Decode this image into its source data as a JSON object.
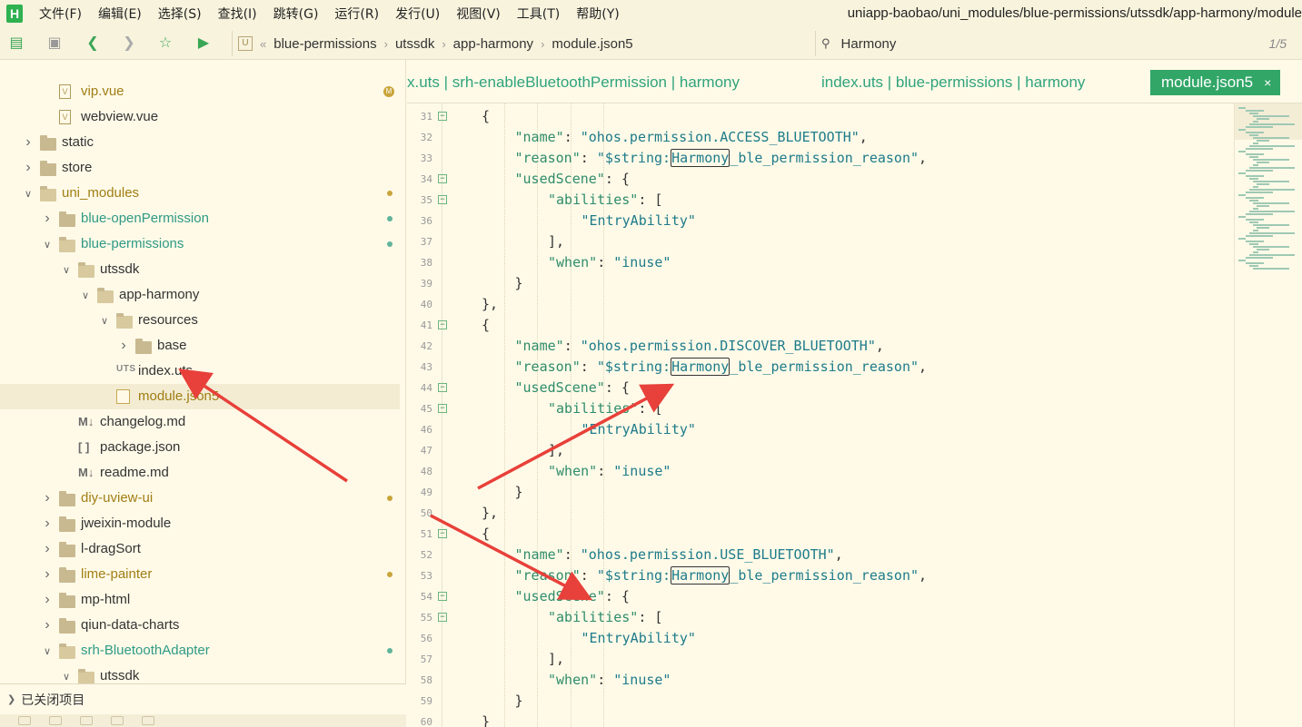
{
  "menu": {
    "items": [
      "文件(F)",
      "编辑(E)",
      "选择(S)",
      "查找(I)",
      "跳转(G)",
      "运行(R)",
      "发行(U)",
      "视图(V)",
      "工具(T)",
      "帮助(Y)"
    ],
    "title_path": "uniapp-baobao/uni_modules/blue-permissions/utssdk/app-harmony/module"
  },
  "toolbar": {
    "breadcrumbs": [
      "blue-permissions",
      "utssdk",
      "app-harmony",
      "module.json5"
    ],
    "search_label": "Harmony",
    "search_count": "1/5"
  },
  "sidebar": {
    "rows": [
      {
        "label": "vip.vue",
        "type": "file-v",
        "depth": 2,
        "chev": "",
        "status": "modified",
        "marker": "M"
      },
      {
        "label": "webview.vue",
        "type": "file-v",
        "depth": 2,
        "chev": "",
        "status": "normal",
        "marker": ""
      },
      {
        "label": "static",
        "type": "folder",
        "depth": 1,
        "chev": "right",
        "status": "normal",
        "marker": ""
      },
      {
        "label": "store",
        "type": "folder",
        "depth": 1,
        "chev": "right",
        "status": "normal",
        "marker": ""
      },
      {
        "label": "uni_modules",
        "type": "folder-open",
        "depth": 1,
        "chev": "down",
        "status": "modified",
        "marker": "yellow"
      },
      {
        "label": "blue-openPermission",
        "type": "folder",
        "depth": 2,
        "chev": "right",
        "status": "added",
        "marker": "green"
      },
      {
        "label": "blue-permissions",
        "type": "folder-open",
        "depth": 2,
        "chev": "down",
        "status": "added",
        "marker": "green"
      },
      {
        "label": "utssdk",
        "type": "folder-open",
        "depth": 3,
        "chev": "down",
        "status": "normal",
        "marker": ""
      },
      {
        "label": "app-harmony",
        "type": "folder-open",
        "depth": 4,
        "chev": "down",
        "status": "normal",
        "marker": ""
      },
      {
        "label": "resources",
        "type": "folder-open",
        "depth": 5,
        "chev": "down",
        "status": "normal",
        "marker": ""
      },
      {
        "label": "base",
        "type": "folder",
        "depth": 6,
        "chev": "right",
        "status": "normal",
        "marker": ""
      },
      {
        "label": "index.uts",
        "type": "uts",
        "depth": 5,
        "chev": "",
        "status": "normal",
        "marker": ""
      },
      {
        "label": "module.json5",
        "type": "file-g",
        "depth": 5,
        "chev": "",
        "status": "modified",
        "marker": "",
        "selected": true
      },
      {
        "label": "changelog.md",
        "type": "md",
        "depth": 3,
        "chev": "",
        "status": "normal",
        "marker": ""
      },
      {
        "label": "package.json",
        "type": "json",
        "depth": 3,
        "chev": "",
        "status": "normal",
        "marker": ""
      },
      {
        "label": "readme.md",
        "type": "md",
        "depth": 3,
        "chev": "",
        "status": "normal",
        "marker": ""
      },
      {
        "label": "diy-uview-ui",
        "type": "folder",
        "depth": 2,
        "chev": "right",
        "status": "modified",
        "marker": "yellow"
      },
      {
        "label": "jweixin-module",
        "type": "folder",
        "depth": 2,
        "chev": "right",
        "status": "normal",
        "marker": ""
      },
      {
        "label": "l-dragSort",
        "type": "folder",
        "depth": 2,
        "chev": "right",
        "status": "normal",
        "marker": ""
      },
      {
        "label": "lime-painter",
        "type": "folder",
        "depth": 2,
        "chev": "right",
        "status": "modified",
        "marker": "yellow"
      },
      {
        "label": "mp-html",
        "type": "folder",
        "depth": 2,
        "chev": "right",
        "status": "normal",
        "marker": ""
      },
      {
        "label": "qiun-data-charts",
        "type": "folder",
        "depth": 2,
        "chev": "right",
        "status": "normal",
        "marker": ""
      },
      {
        "label": "srh-BluetoothAdapter",
        "type": "folder-open",
        "depth": 2,
        "chev": "down",
        "status": "added",
        "marker": "green"
      },
      {
        "label": "utssdk",
        "type": "folder-open",
        "depth": 3,
        "chev": "down",
        "status": "normal",
        "marker": ""
      }
    ],
    "closed_projects": "已关闭项目"
  },
  "tabs": [
    {
      "label": "x.uts | srh-enableBluetoothPermission | harmony",
      "active": false
    },
    {
      "label": "index.uts | blue-permissions | harmony",
      "active": false
    },
    {
      "label": "module.json5",
      "active": true,
      "close": "×"
    }
  ],
  "editor": {
    "lines": [
      {
        "n": "31",
        "fold": true,
        "indent": 3,
        "parts": [
          [
            "p",
            "{"
          ]
        ]
      },
      {
        "n": "32",
        "fold": false,
        "indent": 4,
        "parts": [
          [
            "k",
            "\"name\""
          ],
          [
            "p",
            ": "
          ],
          [
            "s",
            "\"ohos.permission.ACCESS_BLUETOOTH\""
          ],
          [
            "p",
            ","
          ]
        ]
      },
      {
        "n": "33",
        "fold": false,
        "indent": 4,
        "parts": [
          [
            "k",
            "\"reason\""
          ],
          [
            "p",
            ": "
          ],
          [
            "s",
            "\"$string:"
          ],
          [
            "sb",
            "Harmony"
          ],
          [
            "s",
            "_ble_permission_reason\""
          ],
          [
            "p",
            ","
          ]
        ]
      },
      {
        "n": "34",
        "fold": true,
        "indent": 4,
        "parts": [
          [
            "k",
            "\"usedScene\""
          ],
          [
            "p",
            ": {"
          ]
        ]
      },
      {
        "n": "35",
        "fold": true,
        "indent": 5,
        "parts": [
          [
            "k",
            "\"abilities\""
          ],
          [
            "p",
            ": ["
          ]
        ]
      },
      {
        "n": "36",
        "fold": false,
        "indent": 6,
        "parts": [
          [
            "s",
            "\"EntryAbility\""
          ]
        ]
      },
      {
        "n": "37",
        "fold": false,
        "indent": 5,
        "parts": [
          [
            "p",
            "],"
          ]
        ]
      },
      {
        "n": "38",
        "fold": false,
        "indent": 5,
        "parts": [
          [
            "k",
            "\"when\""
          ],
          [
            "p",
            ": "
          ],
          [
            "s",
            "\"inuse\""
          ]
        ]
      },
      {
        "n": "39",
        "fold": false,
        "indent": 4,
        "parts": [
          [
            "p",
            "}"
          ]
        ]
      },
      {
        "n": "40",
        "fold": false,
        "indent": 3,
        "parts": [
          [
            "p",
            "},"
          ]
        ]
      },
      {
        "n": "41",
        "fold": true,
        "indent": 3,
        "parts": [
          [
            "p",
            "{"
          ]
        ]
      },
      {
        "n": "42",
        "fold": false,
        "indent": 4,
        "parts": [
          [
            "k",
            "\"name\""
          ],
          [
            "p",
            ": "
          ],
          [
            "s",
            "\"ohos.permission.DISCOVER_BLUETOOTH\""
          ],
          [
            "p",
            ","
          ]
        ]
      },
      {
        "n": "43",
        "fold": false,
        "indent": 4,
        "parts": [
          [
            "k",
            "\"reason\""
          ],
          [
            "p",
            ": "
          ],
          [
            "s",
            "\"$string:"
          ],
          [
            "sb",
            "Harmony"
          ],
          [
            "s",
            "_ble_permission_reason\""
          ],
          [
            "p",
            ","
          ]
        ]
      },
      {
        "n": "44",
        "fold": true,
        "indent": 4,
        "parts": [
          [
            "k",
            "\"usedScene\""
          ],
          [
            "p",
            ": {"
          ]
        ]
      },
      {
        "n": "45",
        "fold": true,
        "indent": 5,
        "parts": [
          [
            "k",
            "\"abilities\""
          ],
          [
            "p",
            ": ["
          ]
        ]
      },
      {
        "n": "46",
        "fold": false,
        "indent": 6,
        "parts": [
          [
            "s",
            "\"EntryAbility\""
          ]
        ]
      },
      {
        "n": "47",
        "fold": false,
        "indent": 5,
        "parts": [
          [
            "p",
            "],"
          ]
        ]
      },
      {
        "n": "48",
        "fold": false,
        "indent": 5,
        "parts": [
          [
            "k",
            "\"when\""
          ],
          [
            "p",
            ": "
          ],
          [
            "s",
            "\"inuse\""
          ]
        ]
      },
      {
        "n": "49",
        "fold": false,
        "indent": 4,
        "parts": [
          [
            "p",
            "}"
          ]
        ]
      },
      {
        "n": "50",
        "fold": false,
        "indent": 3,
        "parts": [
          [
            "p",
            "},"
          ]
        ]
      },
      {
        "n": "51",
        "fold": true,
        "indent": 3,
        "parts": [
          [
            "p",
            "{"
          ]
        ]
      },
      {
        "n": "52",
        "fold": false,
        "indent": 4,
        "parts": [
          [
            "k",
            "\"name\""
          ],
          [
            "p",
            ": "
          ],
          [
            "s",
            "\"ohos.permission.USE_BLUETOOTH\""
          ],
          [
            "p",
            ","
          ]
        ]
      },
      {
        "n": "53",
        "fold": false,
        "indent": 4,
        "parts": [
          [
            "k",
            "\"reason\""
          ],
          [
            "p",
            ": "
          ],
          [
            "s",
            "\"$string:"
          ],
          [
            "sb",
            "Harmony"
          ],
          [
            "s",
            "_ble_permission_reason\""
          ],
          [
            "p",
            ","
          ]
        ]
      },
      {
        "n": "54",
        "fold": true,
        "indent": 4,
        "parts": [
          [
            "k",
            "\"usedScene\""
          ],
          [
            "p",
            ": {"
          ]
        ]
      },
      {
        "n": "55",
        "fold": true,
        "indent": 5,
        "parts": [
          [
            "k",
            "\"abilities\""
          ],
          [
            "p",
            ": ["
          ]
        ]
      },
      {
        "n": "56",
        "fold": false,
        "indent": 6,
        "parts": [
          [
            "s",
            "\"EntryAbility\""
          ]
        ]
      },
      {
        "n": "57",
        "fold": false,
        "indent": 5,
        "parts": [
          [
            "p",
            "],"
          ]
        ]
      },
      {
        "n": "58",
        "fold": false,
        "indent": 5,
        "parts": [
          [
            "k",
            "\"when\""
          ],
          [
            "p",
            ": "
          ],
          [
            "s",
            "\"inuse\""
          ]
        ]
      },
      {
        "n": "59",
        "fold": false,
        "indent": 4,
        "parts": [
          [
            "p",
            "}"
          ]
        ]
      },
      {
        "n": "60",
        "fold": false,
        "indent": 3,
        "parts": [
          [
            "p",
            "}"
          ]
        ]
      }
    ]
  },
  "colors": {
    "background": "#fffae8",
    "accent_green": "#31a667",
    "json_key": "#2e8c6a",
    "json_string": "#1d7b8a",
    "annotation_arrow": "#e8403a"
  }
}
